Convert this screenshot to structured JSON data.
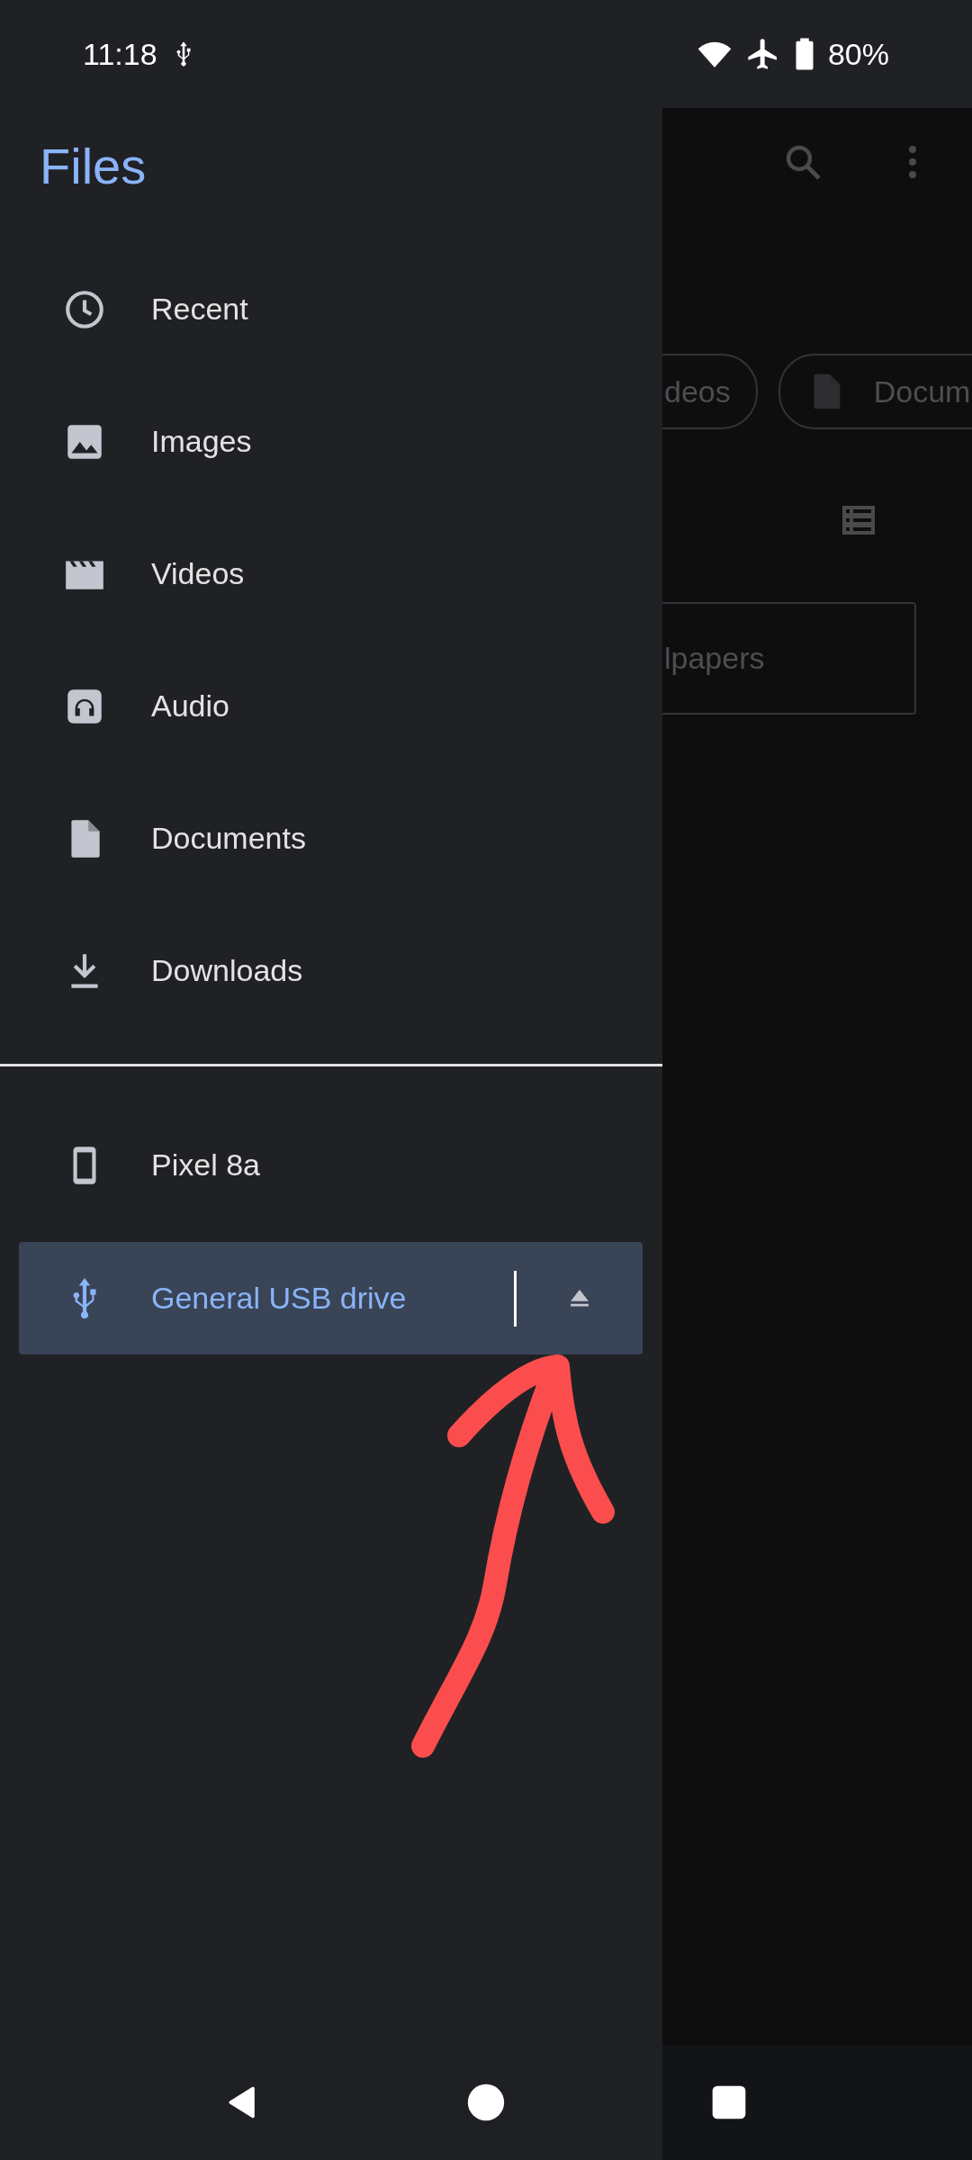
{
  "status_bar": {
    "time": "11:18",
    "battery": "80%"
  },
  "drawer": {
    "title": "Files",
    "items": [
      {
        "label": "Recent",
        "kind": "clock",
        "selected": false
      },
      {
        "label": "Images",
        "kind": "image",
        "selected": false
      },
      {
        "label": "Videos",
        "kind": "video",
        "selected": false
      },
      {
        "label": "Audio",
        "kind": "audio",
        "selected": false
      },
      {
        "label": "Documents",
        "kind": "document",
        "selected": false
      },
      {
        "label": "Downloads",
        "kind": "download",
        "selected": false
      }
    ],
    "devices": [
      {
        "label": "Pixel 8a",
        "kind": "phone",
        "selected": false,
        "eject": false
      },
      {
        "label": "General USB drive",
        "kind": "usb",
        "selected": true,
        "eject": true
      }
    ]
  },
  "background": {
    "chips": [
      {
        "label": "deos",
        "kind": "plain"
      },
      {
        "label": "Docum",
        "kind": "document"
      }
    ],
    "folder": "lpapers"
  }
}
